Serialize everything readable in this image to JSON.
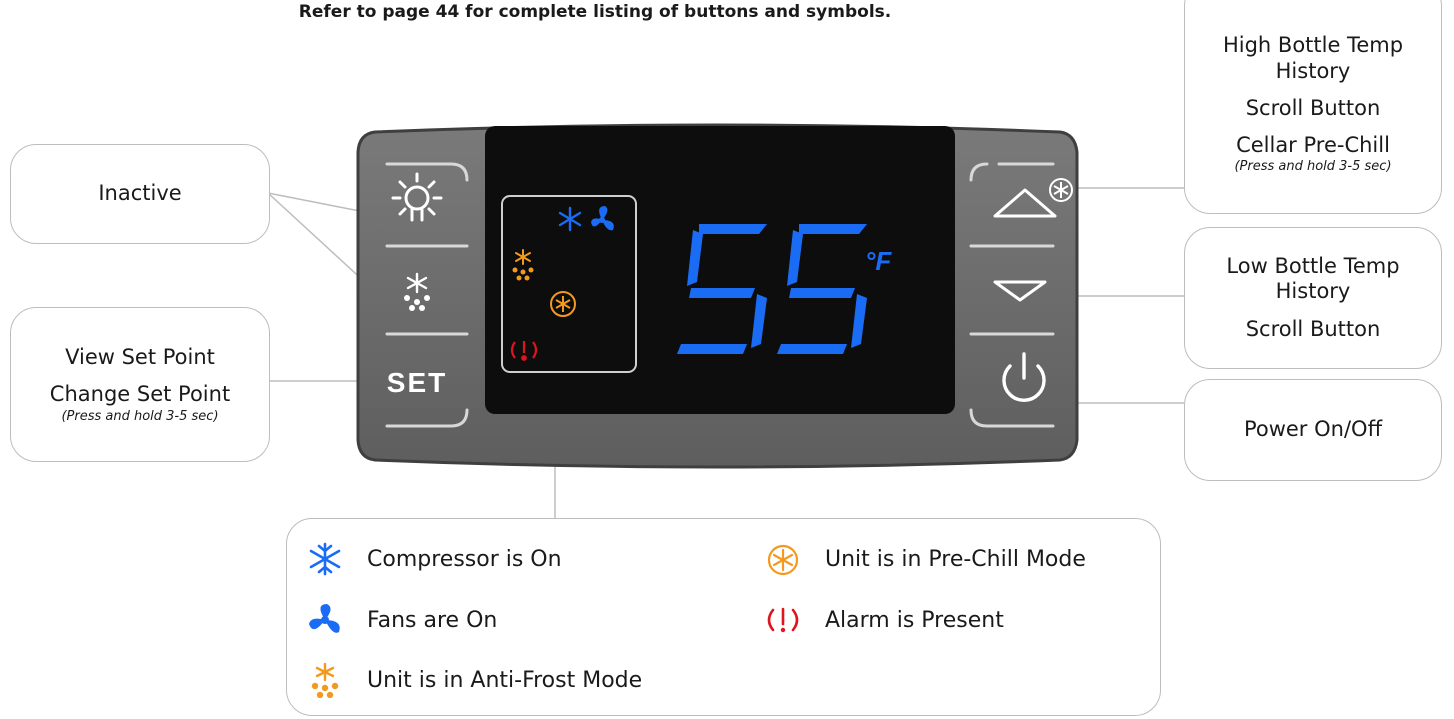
{
  "header_note": "Refer to page 44 for complete listing of buttons and symbols.",
  "display": {
    "temperature": "55",
    "unit": "°F",
    "set_button": "SET"
  },
  "callouts": {
    "inactive": "Inactive",
    "view_set_point": "View Set Point",
    "change_set_point": "Change Set Point",
    "change_set_point_note": "(Press and hold 3-5 sec)",
    "high_bottle_temp_line1": "High Bottle Temp",
    "high_bottle_temp_line2": "History",
    "scroll_button_up": "Scroll Button",
    "cellar_prechill": "Cellar Pre-Chill",
    "cellar_prechill_note": "(Press and hold 3-5 sec)",
    "low_bottle_temp_line1": "Low Bottle Temp",
    "low_bottle_temp_line2": "History",
    "scroll_button_down": "Scroll Button",
    "power": "Power On/Off"
  },
  "legend": [
    {
      "icon": "snowflake-icon",
      "label": "Compressor is On",
      "color": "#1a6cf5"
    },
    {
      "icon": "fan-icon",
      "label": "Fans are On",
      "color": "#1a6cf5"
    },
    {
      "icon": "anti-frost-icon",
      "label": "Unit is in Anti-Frost Mode",
      "color": "#f39a1e"
    },
    {
      "icon": "pre-chill-icon",
      "label": "Unit is in Pre-Chill Mode",
      "color": "#f39a1e"
    },
    {
      "icon": "alarm-icon",
      "label": "Alarm is Present",
      "color": "#e0141e"
    }
  ],
  "colors": {
    "panel": "#6b6b6b",
    "screen": "#0d0d0d",
    "digits": "#1a6cf5",
    "orange": "#f39a1e",
    "red": "#e0141e"
  }
}
